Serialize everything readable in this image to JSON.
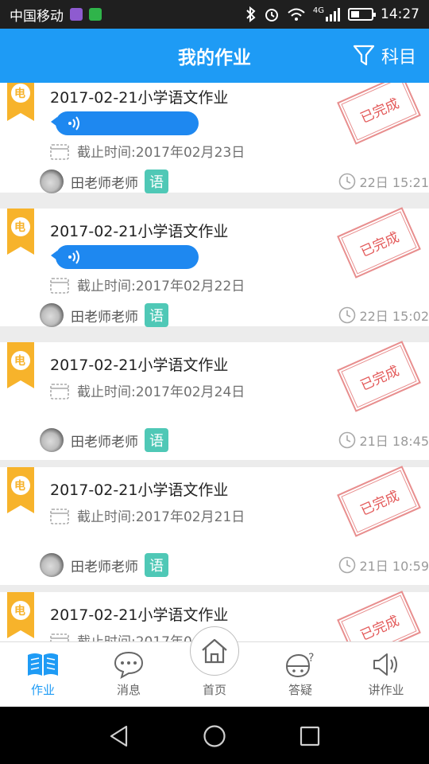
{
  "status_bar": {
    "carrier": "中国移动",
    "network": "4G",
    "time": "14:27",
    "battery_level": 0.4,
    "icons": [
      "gallery-notification-icon",
      "wechat-icon",
      "bluetooth-icon",
      "alarm-icon",
      "wifi-icon",
      "signal-icon",
      "battery-icon"
    ]
  },
  "header": {
    "title": "我的作业",
    "filter_label": "科目",
    "filter_icon": "funnel-icon",
    "background": "#1e9bf5"
  },
  "homework_badge": "电",
  "teacher_label_color": "#4fc8b6",
  "stamp_color": "#e35a5a",
  "homework_items": [
    {
      "title": "2017-02-21小学语文作业",
      "has_voice": true,
      "deadline": "截止时间:2017年02月23日",
      "teacher": "田老师老师",
      "subject": "语",
      "time": "22日 15:21",
      "status": "已完成"
    },
    {
      "title": "2017-02-21小学语文作业",
      "has_voice": true,
      "deadline": "截止时间:2017年02月22日",
      "teacher": "田老师老师",
      "subject": "语",
      "time": "22日 15:02",
      "status": "已完成"
    },
    {
      "title": "2017-02-21小学语文作业",
      "has_voice": false,
      "deadline": "截止时间:2017年02月24日",
      "teacher": "田老师老师",
      "subject": "语",
      "time": "21日 18:45",
      "status": "已完成"
    },
    {
      "title": "2017-02-21小学语文作业",
      "has_voice": false,
      "deadline": "截止时间:2017年02月21日",
      "teacher": "田老师老师",
      "subject": "语",
      "time": "21日 10:59",
      "status": "已完成"
    },
    {
      "title": "2017-02-21小学语文作业",
      "has_voice": false,
      "deadline": "截止时间:2017年0",
      "teacher": "",
      "subject": "",
      "time": "",
      "status": "已完成"
    }
  ],
  "tabs": [
    {
      "label": "作业",
      "icon": "book-icon",
      "active": true
    },
    {
      "label": "消息",
      "icon": "chat-bubble-icon",
      "active": false
    },
    {
      "label": "首页",
      "icon": "home-icon",
      "active": false
    },
    {
      "label": "答疑",
      "icon": "question-face-icon",
      "active": false
    },
    {
      "label": "讲作业",
      "icon": "speaker-icon",
      "active": false
    }
  ],
  "nav_bar": {
    "icons": [
      "back-triangle-icon",
      "home-circle-icon",
      "recents-square-icon"
    ]
  }
}
